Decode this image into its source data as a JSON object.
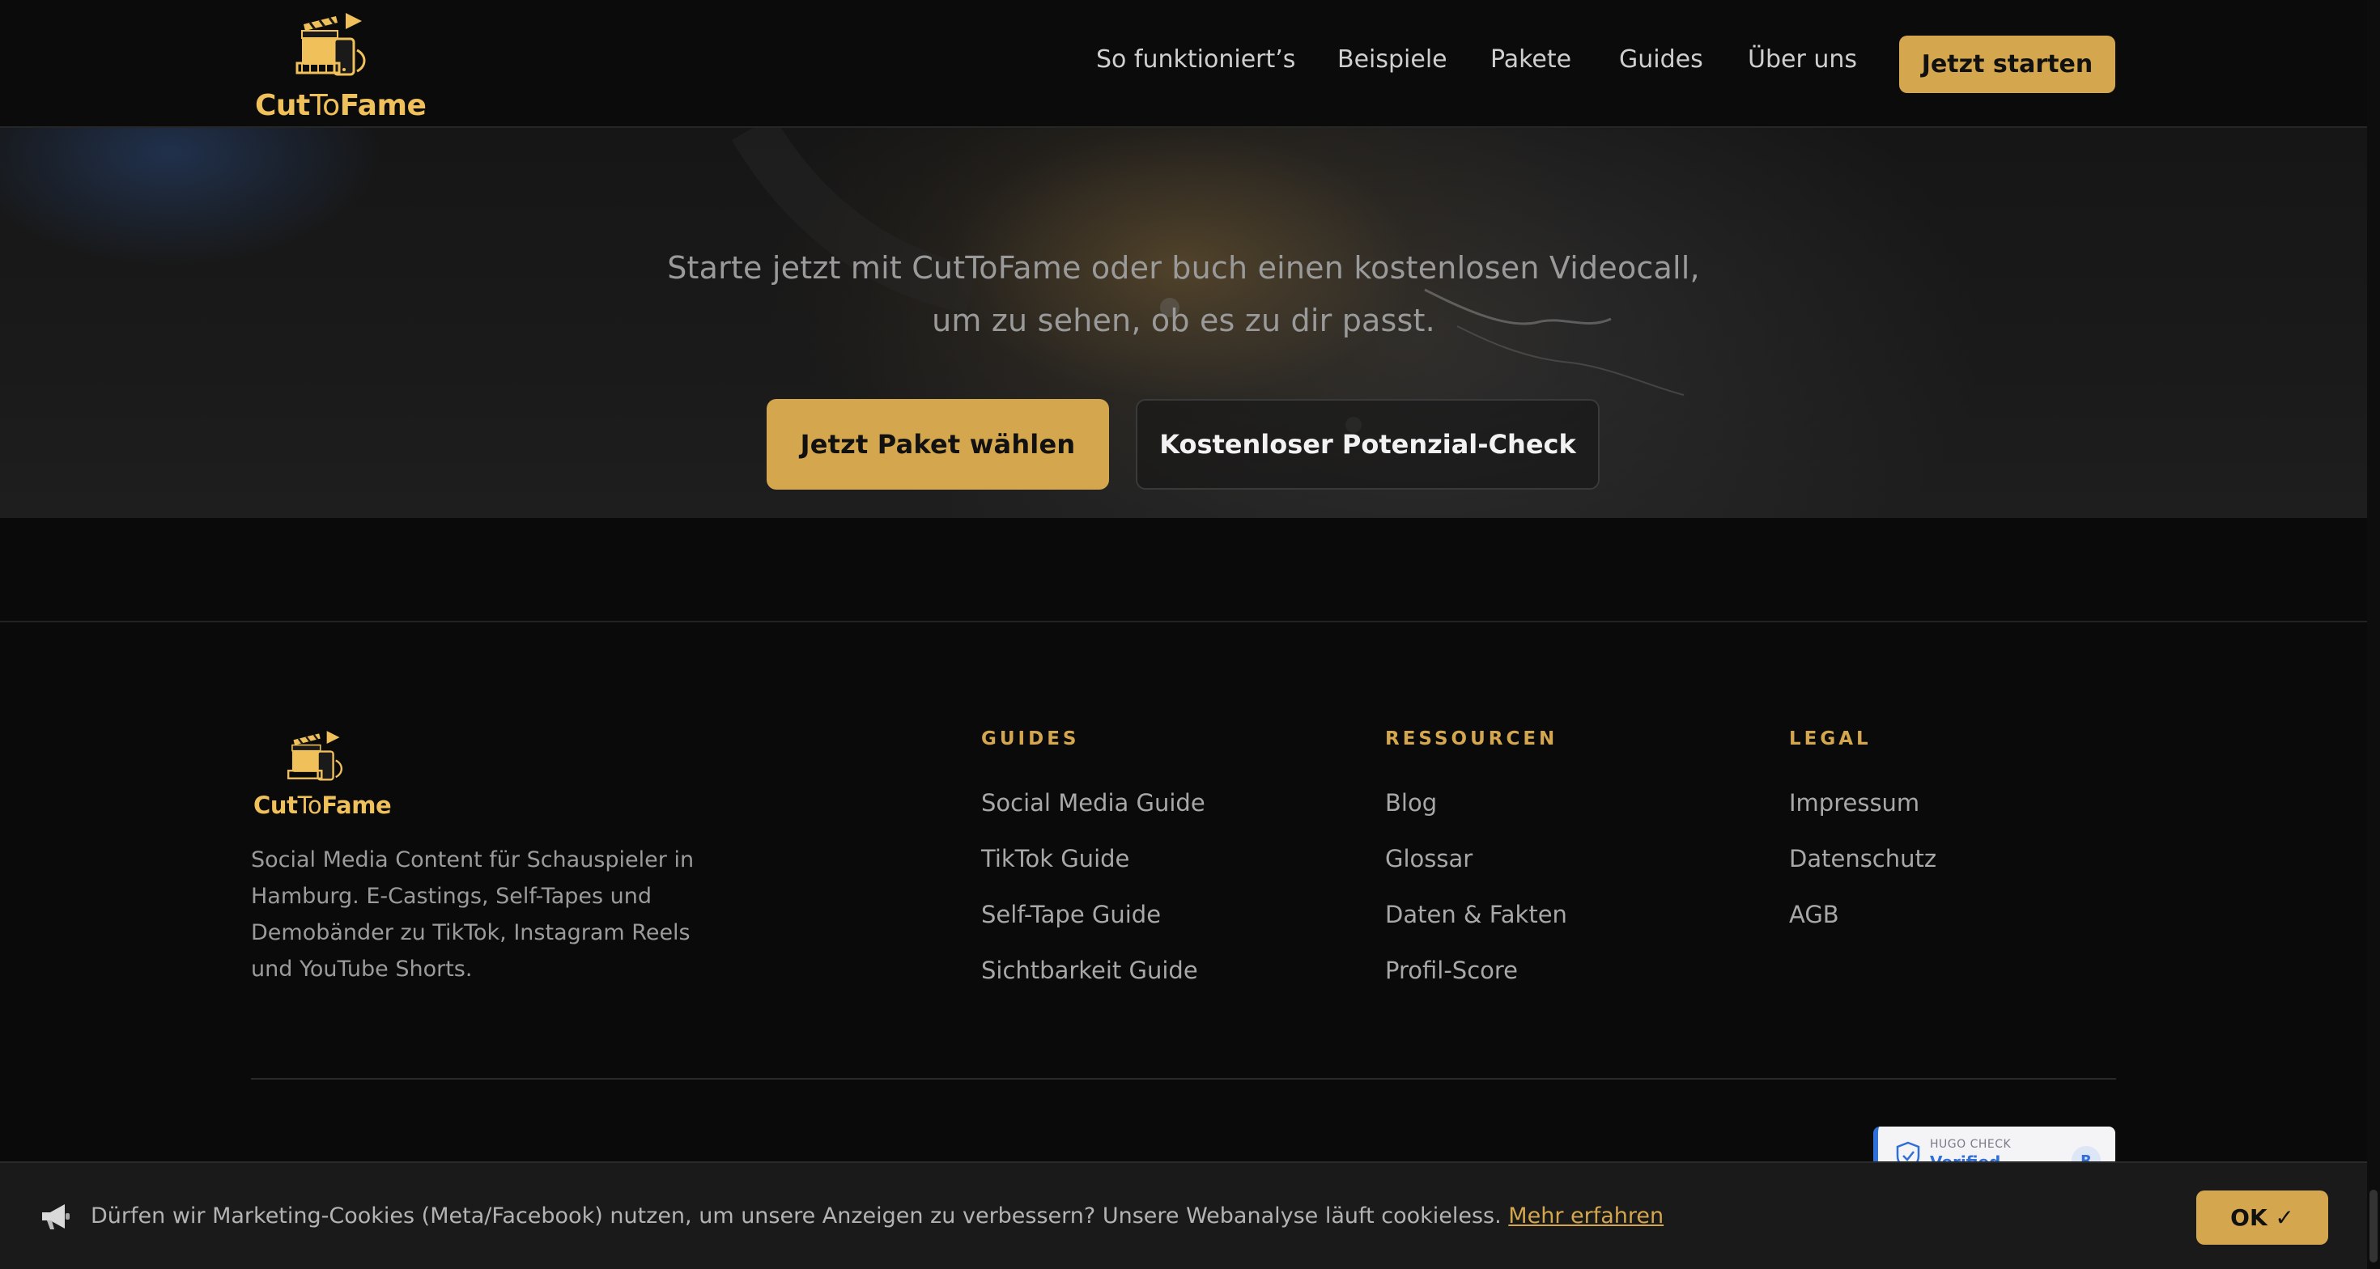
{
  "brand": {
    "name_part1": "Cut",
    "name_part2": "To",
    "name_part3": "Fame"
  },
  "nav": {
    "items": [
      "So funktioniert’s",
      "Beispiele",
      "Pakete",
      "Guides",
      "Über uns"
    ],
    "cta": "Jetzt starten"
  },
  "hero": {
    "subtitle_line1": "Starte jetzt mit CutToFame oder buch einen kostenlosen Videocall,",
    "subtitle_line2": "um zu sehen, ob es zu dir passt.",
    "primary_button": "Jetzt Paket wählen",
    "secondary_button": "Kostenloser Potenzial-Check"
  },
  "footer": {
    "description": "Social Media Content für Schauspieler in Hamburg. E-Castings, Self-Tapes und Demobänder zu TikTok, Instagram Reels und YouTube Shorts.",
    "columns": [
      {
        "title": "GUIDES",
        "links": [
          "Social Media Guide",
          "TikTok Guide",
          "Self-Tape Guide",
          "Sichtbarkeit Guide"
        ]
      },
      {
        "title": "RESSOURCEN",
        "links": [
          "Blog",
          "Glossar",
          "Daten & Fakten",
          "Profil-Score"
        ]
      },
      {
        "title": "LEGAL",
        "links": [
          "Impressum",
          "Datenschutz",
          "AGB"
        ]
      }
    ],
    "hugo_badge": {
      "top": "HUGO CHECK",
      "main": "Verified",
      "mark": "R"
    }
  },
  "cookie": {
    "text": "Dürfen wir Marketing-Cookies (Meta/Facebook) nutzen, um unsere Anzeigen zu verbessern? Unsere Webanalyse läuft cookieless.",
    "link": "Mehr erfahren",
    "ok": "OK ✓"
  },
  "colors": {
    "accent": "#d4a64e",
    "background": "#0a0a0a",
    "text_muted": "#9b9b9b"
  }
}
